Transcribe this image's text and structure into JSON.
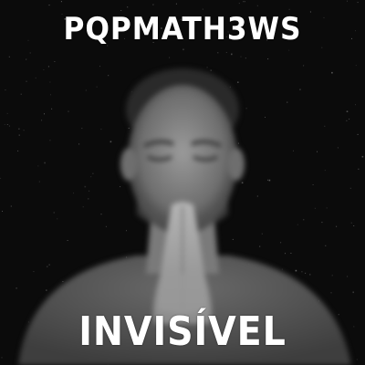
{
  "cover": {
    "artist": "PQPMATH3WS",
    "title": "INVISÍVEL"
  },
  "colors": {
    "background": "#0b0b0b",
    "text": "#ffffff"
  }
}
